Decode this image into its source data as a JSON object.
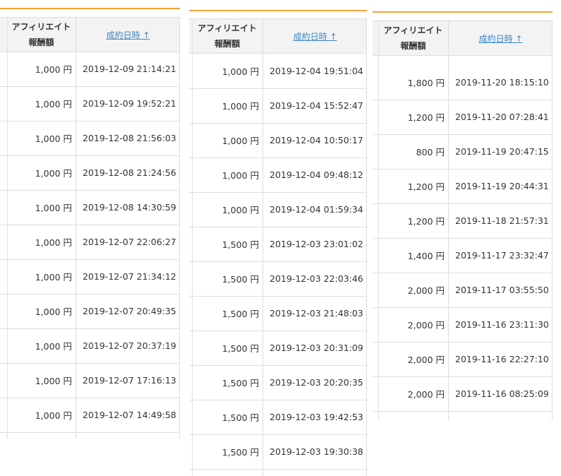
{
  "header": {
    "amount_label_line1": "アフィリエイト",
    "amount_label_line2": "報酬額",
    "date_label": "成約日時 ↑"
  },
  "colors": {
    "accent_line": "#f3a43a",
    "link": "#3c86c6",
    "border": "#dddddd",
    "header_bg": "#f3f3f3"
  },
  "panel1": {
    "rows": [
      {
        "amount": "1,000 円",
        "date": "2019-12-09 21:14:21"
      },
      {
        "amount": "1,000 円",
        "date": "2019-12-09 19:52:21"
      },
      {
        "amount": "1,000 円",
        "date": "2019-12-08 21:56:03"
      },
      {
        "amount": "1,000 円",
        "date": "2019-12-08 21:24:56"
      },
      {
        "amount": "1,000 円",
        "date": "2019-12-08 14:30:59"
      },
      {
        "amount": "1,000 円",
        "date": "2019-12-07 22:06:27"
      },
      {
        "amount": "1,000 円",
        "date": "2019-12-07 21:34:12"
      },
      {
        "amount": "1,000 円",
        "date": "2019-12-07 20:49:35"
      },
      {
        "amount": "1,000 円",
        "date": "2019-12-07 20:37:19"
      },
      {
        "amount": "1,000 円",
        "date": "2019-12-07 17:16:13"
      },
      {
        "amount": "1,000 円",
        "date": "2019-12-07 14:49:58"
      }
    ]
  },
  "panel2": {
    "rows": [
      {
        "amount": "1,000 円",
        "date": "2019-12-04 19:51:04"
      },
      {
        "amount": "1,000 円",
        "date": "2019-12-04 15:52:47"
      },
      {
        "amount": "1,000 円",
        "date": "2019-12-04 10:50:17"
      },
      {
        "amount": "1,000 円",
        "date": "2019-12-04 09:48:12"
      },
      {
        "amount": "1,000 円",
        "date": "2019-12-04 01:59:34"
      },
      {
        "amount": "1,500 円",
        "date": "2019-12-03 23:01:02"
      },
      {
        "amount": "1,500 円",
        "date": "2019-12-03 22:03:46"
      },
      {
        "amount": "1,500 円",
        "date": "2019-12-03 21:48:03"
      },
      {
        "amount": "1,500 円",
        "date": "2019-12-03 20:31:09"
      },
      {
        "amount": "1,500 円",
        "date": "2019-12-03 20:20:35"
      },
      {
        "amount": "1,500 円",
        "date": "2019-12-03 19:42:53"
      },
      {
        "amount": "1,500 円",
        "date": "2019-12-03 19:30:38"
      }
    ]
  },
  "panel3": {
    "rows": [
      {
        "amount": "1,800 円",
        "date": "2019-11-20 18:15:10"
      },
      {
        "amount": "1,200 円",
        "date": "2019-11-20 07:28:41"
      },
      {
        "amount": "800 円",
        "date": "2019-11-19 20:47:15"
      },
      {
        "amount": "1,200 円",
        "date": "2019-11-19 20:44:31"
      },
      {
        "amount": "1,200 円",
        "date": "2019-11-18 21:57:31"
      },
      {
        "amount": "1,400 円",
        "date": "2019-11-17 23:32:47"
      },
      {
        "amount": "2,000 円",
        "date": "2019-11-17 03:55:50"
      },
      {
        "amount": "2,000 円",
        "date": "2019-11-16 23:11:30"
      },
      {
        "amount": "2,000 円",
        "date": "2019-11-16 22:27:10"
      },
      {
        "amount": "2,000 円",
        "date": "2019-11-16 08:25:09"
      }
    ]
  }
}
